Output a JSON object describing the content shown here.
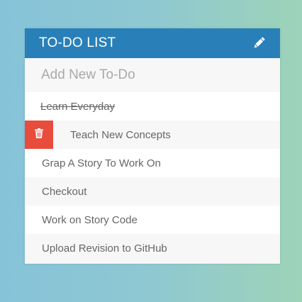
{
  "header": {
    "title": "TO-DO LIST",
    "edit_icon": "pencil-icon"
  },
  "add_input": {
    "placeholder": "Add New To-Do",
    "value": ""
  },
  "todos": [
    {
      "text": "Learn Everyday",
      "completed": true,
      "show_delete": false
    },
    {
      "text": "Teach New Concepts",
      "completed": false,
      "show_delete": true
    },
    {
      "text": "Grap A Story To Work On",
      "completed": false,
      "show_delete": false
    },
    {
      "text": "Checkout",
      "completed": false,
      "show_delete": false
    },
    {
      "text": "Work on Story Code",
      "completed": false,
      "show_delete": false
    },
    {
      "text": "Upload Revision to GitHub",
      "completed": false,
      "show_delete": false
    }
  ],
  "delete_icon": "trash-icon",
  "colors": {
    "header_bg": "#2980b9",
    "delete_bg": "#e74c3c",
    "text": "#666666"
  }
}
